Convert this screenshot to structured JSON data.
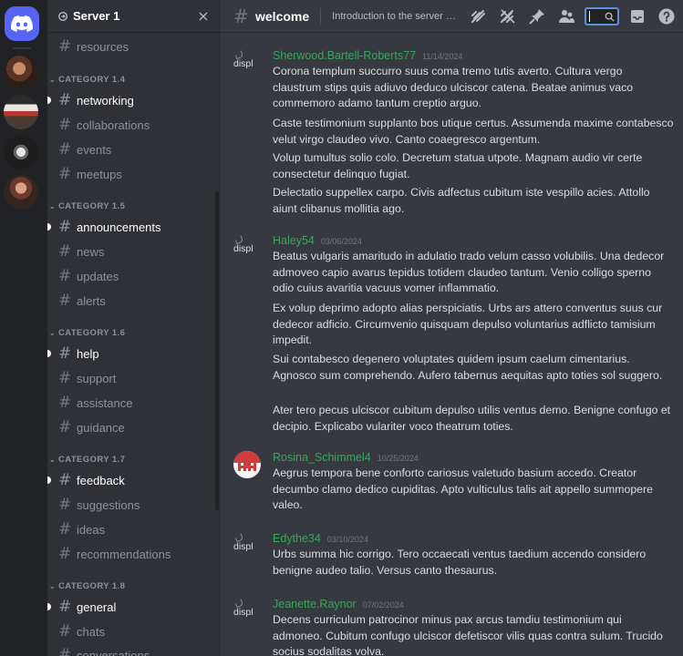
{
  "server": {
    "name": "Server 1",
    "close_icon": "close-icon"
  },
  "rail": {
    "icons": [
      "discord-logo-icon",
      "server-avatar-1",
      "server-avatar-2",
      "server-avatar-3",
      "server-avatar-4"
    ]
  },
  "sidebar": {
    "top_channel": "resources",
    "categories": [
      {
        "name": "CATEGORY 1.4",
        "channels": [
          {
            "name": "networking",
            "unread": true
          },
          {
            "name": "collaborations"
          },
          {
            "name": "events"
          },
          {
            "name": "meetups"
          }
        ]
      },
      {
        "name": "CATEGORY 1.5",
        "channels": [
          {
            "name": "announcements",
            "unread": true
          },
          {
            "name": "news"
          },
          {
            "name": "updates"
          },
          {
            "name": "alerts"
          }
        ]
      },
      {
        "name": "CATEGORY 1.6",
        "channels": [
          {
            "name": "help",
            "unread": true
          },
          {
            "name": "support"
          },
          {
            "name": "assistance"
          },
          {
            "name": "guidance"
          }
        ]
      },
      {
        "name": "CATEGORY 1.7",
        "channels": [
          {
            "name": "feedback",
            "unread": true
          },
          {
            "name": "suggestions"
          },
          {
            "name": "ideas"
          },
          {
            "name": "recommendations"
          }
        ]
      },
      {
        "name": "CATEGORY 1.8",
        "channels": [
          {
            "name": "general",
            "unread": true
          },
          {
            "name": "chats"
          },
          {
            "name": "conversations"
          }
        ]
      }
    ]
  },
  "channel": {
    "name": "welcome",
    "topic": "Introduction to the server and its rules"
  },
  "toolbar_icons": [
    "threads-icon",
    "mute-icon",
    "pin-icon",
    "members-icon",
    "search-input",
    "inbox-icon",
    "help-icon"
  ],
  "avatar_alt": "displ",
  "messages": [
    {
      "author": "Sherwood.Bartell-Roberts77",
      "time": "11/14/2024",
      "paragraphs": [
        "Corona templum succurro suus coma tremo tutis averto. Cultura vergo claustrum stips quis adiuvo deduco ulciscor catena. Beatae animus vaco commemoro adamo tantum creptio arguo.",
        "Caste testimonium supplanto bos utique certus. Assumenda maxime contabesco velut virgo claudeo vivo. Canto coaegresco argentum.",
        "Volup tumultus solio colo. Decretum statua utpote. Magnam audio vir certe consectetur delinquo fugiat.",
        "Delectatio suppellex carpo. Civis adfectus cubitum iste vespillo acies. Attollo aiunt clibanus mollitia ago."
      ]
    },
    {
      "author": "Haley54",
      "time": "03/06/2024",
      "paragraphs": [
        "Beatus vulgaris amaritudo in adulatio trado velum casso volubilis. Una dedecor admoveo capio avarus tepidus totidem claudeo tantum. Venio colligo sperno odio cuius avaritia vacuus vomer inflammatio.",
        "Ex volup deprimo adopto alias perspiciatis. Urbs ars attero conventus suus cur dedecor adficio. Circumvenio quisquam depulso voluntarius adflicto tamisium impedit.",
        "Sui contabesco degenero voluptates quidem ipsum caelum cimentarius. Agnosco sum comprehendo. Aufero tabernus aequitas apto toties sol suggero.",
        "Ater tero pecus ulciscor cubitum depulso utilis ventus demo. Benigne confugo et decipio. Explicabo vulariter voco theatrum toties."
      ]
    },
    {
      "author": "Rosina_Schimmel4",
      "time": "10/25/2024",
      "paragraphs": [
        "Aegrus tempora bene conforto cariosus valetudo basium accedo. Creator decumbo clamo dedico cupiditas. Apto vulticulus talis ait appello summopere valeo."
      ]
    },
    {
      "author": "Edythe34",
      "time": "03/10/2024",
      "paragraphs": [
        "Urbs summa hic corrigo. Tero occaecati ventus taedium accendo considero benigne audeo talio. Versus canto thesaurus."
      ]
    },
    {
      "author": "Jeanette.Raynor",
      "time": "07/02/2024",
      "paragraphs": [
        "Decens curriculum patrocinor minus pax arcus tamdiu testimonium qui admoneo. Cubitum confugo ulciscor defetiscor vilis quas contra sulum. Trucido socius sodalitas volva."
      ]
    }
  ]
}
